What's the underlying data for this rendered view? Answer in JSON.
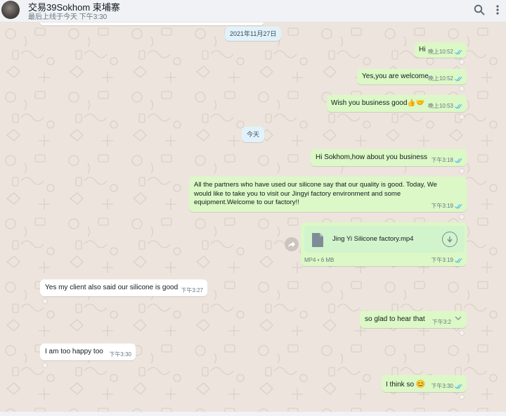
{
  "header": {
    "title": "交易39Sokhom 束埔寨",
    "subtitle": "最后上线于今天 下午3:30",
    "icons": [
      "search-icon",
      "menu-icon"
    ]
  },
  "chat": {
    "date_chips": [
      "2021年11月27日",
      "今天"
    ],
    "messages": [
      {
        "text": "Hi",
        "time": "晚上10:52",
        "direction": "out",
        "status": "read"
      },
      {
        "text": "Yes,you are welcome",
        "time": "晚上10:52",
        "direction": "out",
        "status": "read"
      },
      {
        "text": "Wish you business good",
        "emoji": "👍🤝",
        "time": "晚上10:53",
        "direction": "out",
        "status": "read"
      },
      {
        "text": "Hi Sokhom,how about you business",
        "time": "下午3:18",
        "direction": "out",
        "status": "read"
      },
      {
        "lines": [
          "All the partners who have used our silicone say that our quality is good. Today, We",
          "would like to take you to visit our Jingyi factory environment and some",
          "equipment.Welcome to our factory!!"
        ],
        "time": "下午3:19",
        "direction": "out",
        "status": "read"
      },
      {
        "file_name": "Jing Yi Silicone factory.mp4",
        "file_info": "MP4 • 6 MB",
        "time": "下午3:19",
        "direction": "out",
        "status": "read"
      },
      {
        "text": "Yes my client also said our silicone is good",
        "time": "下午3:27",
        "direction": "in"
      },
      {
        "text": "so glad to hear that",
        "time": "下午3:2",
        "direction": "out",
        "status": "read"
      },
      {
        "text": "I am too happy too",
        "time": "下午3:30",
        "direction": "in"
      },
      {
        "text": "I think so",
        "emoji": "😊",
        "time": "下午3:30",
        "direction": "out",
        "status": "read"
      }
    ]
  },
  "colors": {
    "outgoing": "#dcf8c6",
    "incoming": "#ffffff",
    "background": "#ede5dd",
    "read_tick": "#53bdeb"
  }
}
